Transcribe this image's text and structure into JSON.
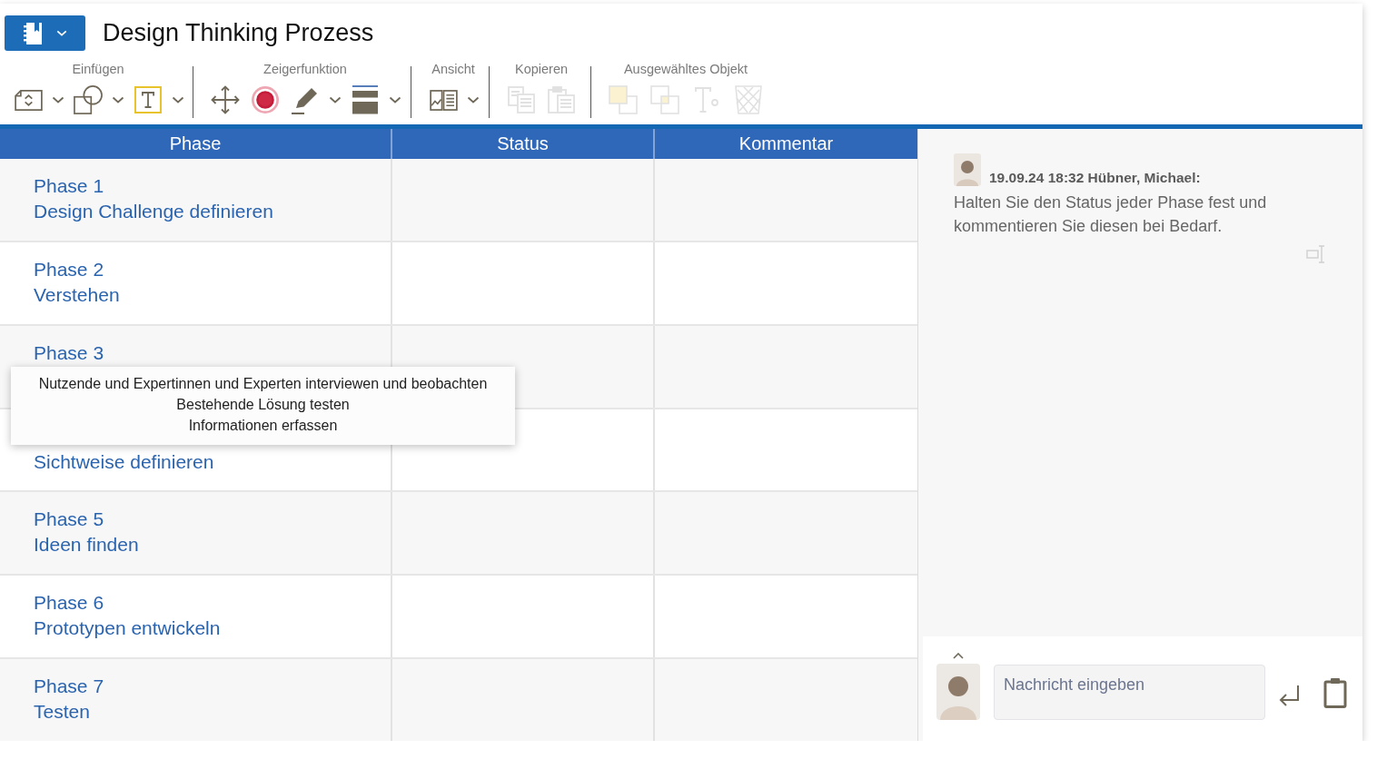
{
  "document": {
    "title": "Design Thinking Prozess"
  },
  "toolbar": [
    {
      "label": "Einfügen",
      "items": [
        {
          "disabled": false,
          "menu": true
        },
        {
          "disabled": false,
          "menu": true
        },
        {
          "disabled": false,
          "menu": true
        }
      ]
    },
    {
      "label": "Zeigerfunktion",
      "items": [
        {
          "disabled": false,
          "menu": false
        },
        {
          "disabled": false,
          "menu": false
        },
        {
          "disabled": false,
          "menu": true
        },
        {
          "disabled": false,
          "menu": true
        }
      ]
    },
    {
      "label": "Ansicht",
      "items": [
        {
          "disabled": false,
          "menu": true
        }
      ]
    },
    {
      "label": "Kopieren",
      "items": [
        {
          "disabled": true,
          "menu": false
        },
        {
          "disabled": true,
          "menu": false
        }
      ]
    },
    {
      "label": "Ausgewähltes Objekt",
      "items": [
        {
          "disabled": true,
          "menu": false
        },
        {
          "disabled": true,
          "menu": false
        },
        {
          "disabled": true,
          "menu": false
        },
        {
          "disabled": true,
          "menu": false
        }
      ]
    }
  ],
  "table": {
    "columns": [
      "Phase",
      "Status",
      "Kommentar"
    ],
    "rows": [
      {
        "phase": "Phase 1",
        "name": "Design Challenge definieren"
      },
      {
        "phase": "Phase 2",
        "name": "Verstehen"
      },
      {
        "phase": "Phase 3"
      },
      {
        "name": "Sichtweise definieren"
      },
      {
        "phase": "Phase 5",
        "name": "Ideen finden"
      },
      {
        "phase": "Phase 6",
        "name": "Prototypen entwickeln"
      },
      {
        "phase": "Phase 7",
        "name": "Testen"
      }
    ]
  },
  "tooltip": {
    "lines": [
      "Nutzende und Expertinnen und Experten interviewen und beobachten",
      "Bestehende Lösung testen",
      "Informationen erfassen"
    ]
  },
  "comments": [
    {
      "meta": "19.09.24 18:32 Hübner, Michael:",
      "text": "Halten Sie den Status jeder Phase fest und kommentieren Sie diesen bei Bedarf."
    }
  ],
  "composer": {
    "placeholder": "Nachricht eingeben"
  }
}
